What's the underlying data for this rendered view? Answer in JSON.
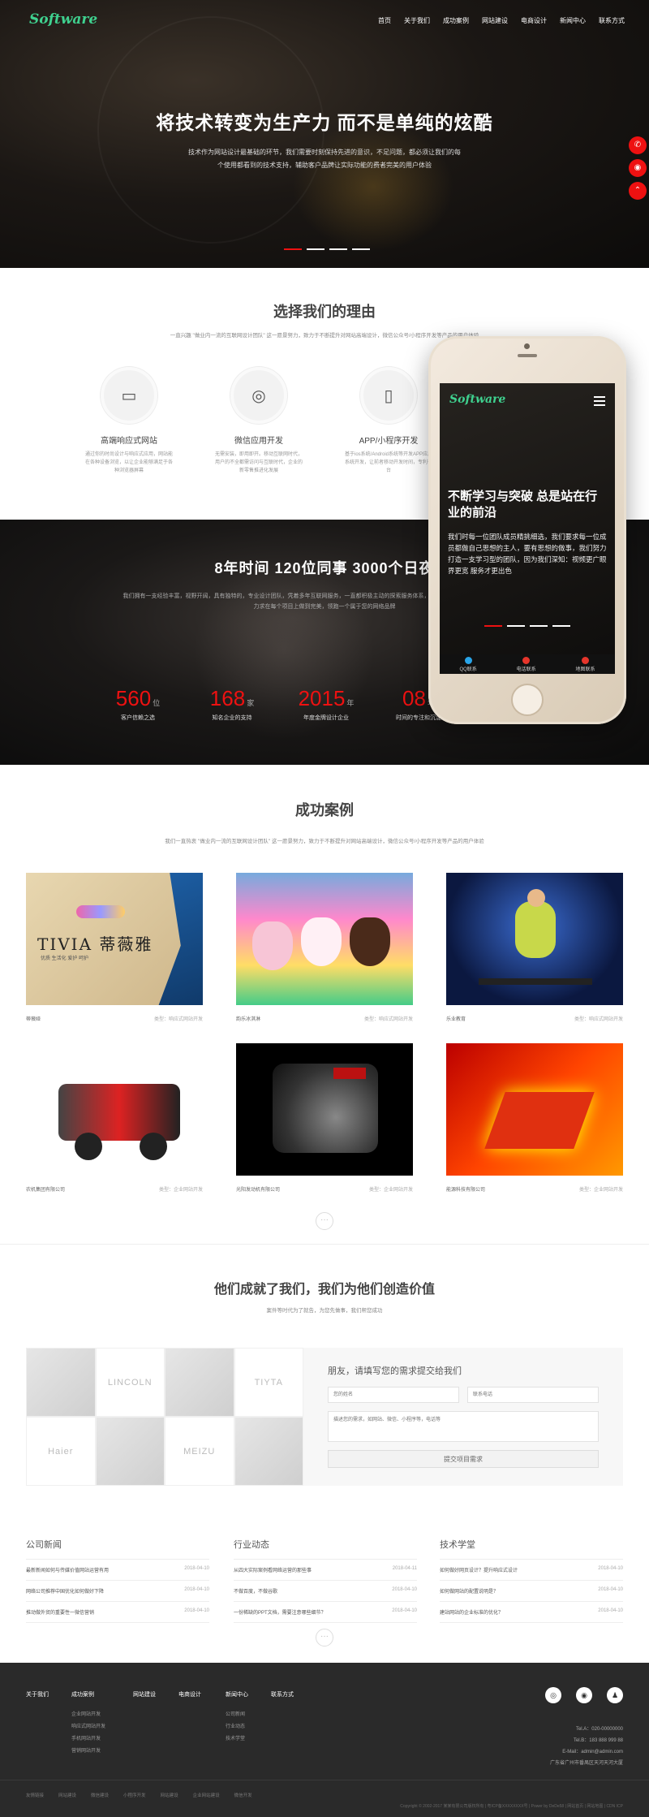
{
  "header": {
    "logo": "Software",
    "nav": [
      "首页",
      "关于我们",
      "成功案例",
      "网站建设",
      "电商设计",
      "新闻中心",
      "联系方式"
    ]
  },
  "hero": {
    "title": "将技术转变为生产力 而不是单纯的炫酷",
    "desc": "技术作为网站设计最基础的环节，我们需要时刻保持先进的意识，不足问题，都必须让我们的每个使用都看到的技术支持，辅助客户品牌让实际功能的费者完美的用户体验",
    "dots": 4,
    "active_dot": 0
  },
  "side_icons": [
    "phone-icon",
    "chat-icon",
    "arrow-up-icon"
  ],
  "reasons": {
    "title": "选择我们的理由",
    "sub": "一直兴趣 \"做业内一流的互联网设计团队\" 这一愿景努力，致力于不断提升对网站高端设计，微信公众号/小程序开发等产品的用户体验",
    "features": [
      {
        "icon": "devices-icon",
        "glyph": "▭",
        "title": "高端响应式网站",
        "desc": "通过你的时尚设计与响应式应用，网站能在各种设备浏览，以让企业能够满足于各种浏览器屏幕"
      },
      {
        "icon": "wechat-icon",
        "glyph": "◎",
        "title": "微信应用开发",
        "desc": "无需安装，即用即开。移动互联网时代，用户的不全都需访问与互联时代，企业的新零售推进化发展"
      },
      {
        "icon": "mini-program-icon",
        "glyph": "▯",
        "title": "APP/小程序开发",
        "desc": "基于ios系统/Android系统等开发APP应用系统开发，让前者移动开发时间，专利平台"
      }
    ]
  },
  "stats": {
    "title": "8年时间  120位同事  3000个日夜",
    "desc": "我们拥有一支经验丰富，视野开阔，具有独特的，专业设计团队，凭着多年互联网服务，一直都积极主动的探索服务体系，我们用心用质量研发每一个客户作品，力求在每个项目上做到完美，领跑一个属于您的网络品牌",
    "items": [
      {
        "num": "560",
        "unit": "位",
        "label": "客户信赖之选"
      },
      {
        "num": "168",
        "unit": "家",
        "label": "知名企业的支持"
      },
      {
        "num": "2015",
        "unit": "年",
        "label": "年度金牌设计企业"
      },
      {
        "num": "08",
        "unit": "年",
        "label": "时间的专注和沉淀"
      }
    ]
  },
  "phone": {
    "logo": "Software",
    "title": "不断学习与突破 总是站在行业的前沿",
    "desc": "我们时每一位团队成员精挑细选，我们要求每一位成员都做自己思想的主人，要有思想的做事，我们努力打造一支学习型的团队，因为我们深知：视频更广眼界更宽 服务才更出色",
    "tabs": [
      "QQ联系",
      "电话联系",
      "地图联系"
    ]
  },
  "cases": {
    "title": "成功案例",
    "sub": "我们一直热衷 \"做业内一流的互联网设计团队\" 这一愿景努力，致力于不断提升对网站高端设计，微信公众号/小程序开发等产品的用户体验",
    "tag": "类型：响应式网站开发",
    "more": "···",
    "items": [
      {
        "name": "蒂薇娅",
        "img": "tivia",
        "tag": "类型：响应式网站开发",
        "label": "TIVIA 蒂薇雅",
        "sub": "优质  生活化  爱护  呵护"
      },
      {
        "name": "韵乐冰淇淋",
        "img": "ice-cream",
        "tag": "类型：响应式网站开发"
      },
      {
        "name": "乐业教育",
        "img": "skate",
        "tag": "类型：响应式网站开发"
      },
      {
        "name": "农机集团有限公司",
        "img": "harvester",
        "tag": "类型：企业网站开发"
      },
      {
        "name": "光阳发动机有限公司",
        "img": "engine",
        "tag": "类型：企业网站开发"
      },
      {
        "name": "能源科技有限公司",
        "img": "energy",
        "tag": "类型：企业网站开发"
      }
    ]
  },
  "contact": {
    "title": "他们成就了我们，我们为他们创造价值",
    "sub": "案件等时代为了就告，为您先做事，我们帮您成功",
    "clients": [
      "",
      "LINCOLN",
      "",
      "TIYTA",
      "Haier",
      "",
      "MEIZU",
      ""
    ],
    "form": {
      "title": "朋友，请填写您的需求提交给我们",
      "name_ph": "您的姓名",
      "phone_ph": "联系电话",
      "msg_ph": "描述您的需求，如网站、微信、小程序等，电话等",
      "submit": "提交项目需求"
    }
  },
  "news": {
    "more": "···",
    "cols": [
      {
        "title": "公司新闻",
        "items": [
          {
            "t": "最新新闻如何与传媒价值网站运营有用",
            "d": "2018-04-10"
          },
          {
            "t": "网络公司推荐中国优化如何做好下降",
            "d": "2018-04-10"
          },
          {
            "t": "推动做外贸的重要性一微信营销",
            "d": "2018-04-10"
          }
        ]
      },
      {
        "title": "行业动态",
        "items": [
          {
            "t": "从四大实际案例看网络运营的那些事",
            "d": "2018-04-11"
          },
          {
            "t": "不做百度，不做谷歌",
            "d": "2018-04-10"
          },
          {
            "t": "一份稀缺的PPT文档，需要注意哪些细节？",
            "d": "2018-04-10"
          }
        ]
      },
      {
        "title": "技术学堂",
        "items": [
          {
            "t": "如何做好网页设计？提升响应式设计",
            "d": "2018-04-10"
          },
          {
            "t": "如何做网站的配置说明是？",
            "d": "2018-04-10"
          },
          {
            "t": "建站网站的企业标准的优化？",
            "d": "2018-04-10"
          }
        ]
      }
    ]
  },
  "footer": {
    "cols": [
      {
        "title": "关于我们",
        "links": []
      },
      {
        "title": "成功案例",
        "links": [
          "企业网站开发",
          "响应式网站开发",
          "手机网站开发",
          "营销网站开发"
        ]
      },
      {
        "title": "网站建设",
        "links": []
      },
      {
        "title": "电商设计",
        "links": []
      },
      {
        "title": "新闻中心",
        "links": [
          "公司新闻",
          "行业动态",
          "技术学堂"
        ]
      },
      {
        "title": "联系方式",
        "links": []
      }
    ],
    "contact_lines": [
      "Tel.A：020-00000000",
      "Tel.B：183 888 999 88",
      "E-Mail：admin@admin.com",
      "广东省广州市番禺区天河天河大厦"
    ],
    "copy_links": [
      "友情链接",
      "网站建设",
      "微信建设",
      "小程序开发",
      "网站建设",
      "企业网站建设",
      "微信开发"
    ],
    "copyright": "Copyright © 2002-2017 某某有限公司版权所有 | 粤ICP备XXXXXXXX号 | Power by DeDe58 | 网站首页 | 网站地图 | CDN ICP"
  }
}
